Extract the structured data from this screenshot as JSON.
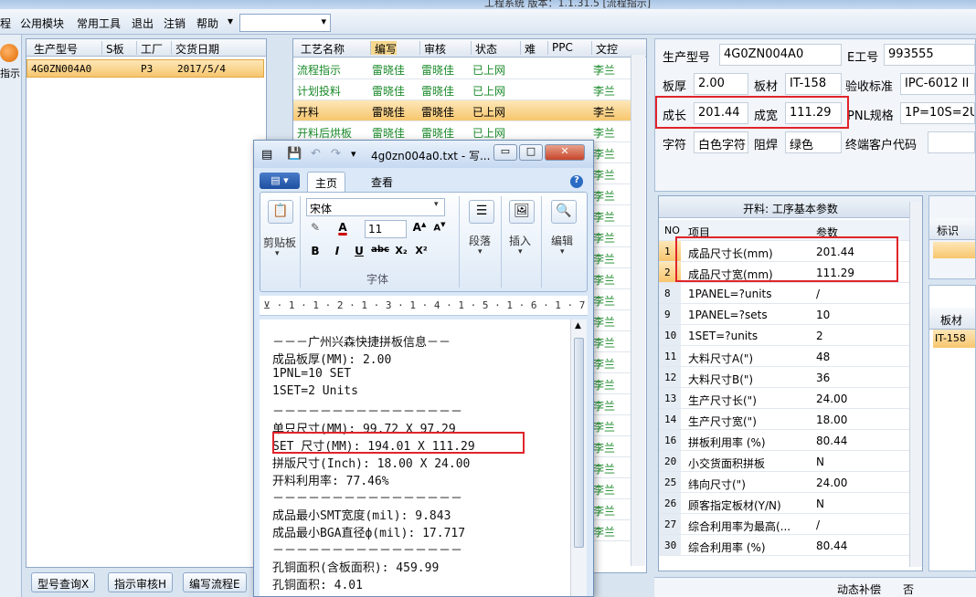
{
  "app": {
    "title": "工程系统  版本：1.1.31.5   [流程指示]"
  },
  "menu": {
    "items": [
      "程",
      "公用模块",
      "常用工具",
      "退出",
      "注销",
      "帮助"
    ],
    "combo_value": ""
  },
  "leftstrip": {
    "label": "指示"
  },
  "list": {
    "headers": [
      "生产型号",
      "S板",
      "工厂",
      "交货日期"
    ],
    "rows": [
      {
        "model": "4G0ZN004A0",
        "s": "",
        "factory": "P3",
        "date": "2017/5/4"
      }
    ]
  },
  "bottom_buttons": [
    "型号查询X",
    "指示审核H",
    "编写流程E"
  ],
  "process": {
    "headers": [
      "工艺名称",
      "编写",
      "审核",
      "状态",
      "难",
      "PPC",
      "文控"
    ],
    "rows": [
      {
        "name": "流程指示",
        "writer": "雷晓佳",
        "auditor": "雷晓佳",
        "status": "已上网",
        "ctrl": "李兰",
        "selected": false
      },
      {
        "name": "计划投料",
        "writer": "雷晓佳",
        "auditor": "雷晓佳",
        "status": "已上网",
        "ctrl": "李兰",
        "selected": false
      },
      {
        "name": "开料",
        "writer": "雷晓佳",
        "auditor": "雷晓佳",
        "status": "已上网",
        "ctrl": "李兰",
        "selected": true
      },
      {
        "name": "开料后烘板",
        "writer": "雷晓佳",
        "auditor": "雷晓佳",
        "status": "已上网",
        "ctrl": "李兰",
        "selected": false
      },
      {
        "ctrl": "李兰"
      },
      {
        "ctrl": "李兰"
      },
      {
        "ctrl": "李兰"
      },
      {
        "ctrl": "李兰"
      },
      {
        "ctrl": "李兰"
      },
      {
        "ctrl": "李兰"
      },
      {
        "ctrl": "李兰"
      },
      {
        "ctrl": "李兰"
      },
      {
        "ctrl": "李兰"
      },
      {
        "ctrl": "李兰"
      },
      {
        "ctrl": "李兰"
      },
      {
        "ctrl": "李兰"
      },
      {
        "ctrl": "李兰"
      },
      {
        "ctrl": "李兰"
      },
      {
        "ctrl": "李兰"
      },
      {
        "ctrl": "李兰"
      },
      {
        "ctrl": "李兰"
      },
      {
        "ctrl": "李兰"
      },
      {
        "ctrl": "李兰"
      }
    ]
  },
  "info": {
    "model_label": "生产型号",
    "model_value": "4G0ZN004A0",
    "eno_label": "E工号",
    "eno_value": "993555",
    "thick_label": "板厚",
    "thick_value": "2.00",
    "material_label": "板材",
    "material_value": "IT-158",
    "std_label": "验收标准",
    "std_value": "IPC-6012 II",
    "len_label": "成长",
    "len_value": "201.44",
    "wid_label": "成宽",
    "wid_value": "111.29",
    "pnl_label": "PNL规格",
    "pnl_value": "1P=10S=2U",
    "char_label": "字符",
    "char_value": "白色字符",
    "mask_label": "阻焊",
    "mask_value": "绿色",
    "cust_label": "终端客户代码",
    "cust_value": ""
  },
  "params": {
    "title": "开料: 工序基本参数",
    "headers": [
      "NO",
      "项目",
      "参数"
    ],
    "rows": [
      {
        "no": "1",
        "item": "成品尺寸长(mm)",
        "val": "201.44",
        "hl": true
      },
      {
        "no": "2",
        "item": "成品尺寸宽(mm)",
        "val": "111.29",
        "hl": true
      },
      {
        "no": "8",
        "item": "1PANEL=?units",
        "val": "/"
      },
      {
        "no": "9",
        "item": "1PANEL=?sets",
        "val": "10"
      },
      {
        "no": "10",
        "item": "1SET=?units",
        "val": "2"
      },
      {
        "no": "11",
        "item": "大料尺寸A(\")",
        "val": "48"
      },
      {
        "no": "12",
        "item": "大料尺寸B(\")",
        "val": "36"
      },
      {
        "no": "13",
        "item": "生产尺寸长(\")",
        "val": "24.00"
      },
      {
        "no": "14",
        "item": "生产尺寸宽(\")",
        "val": "18.00"
      },
      {
        "no": "16",
        "item": "拼板利用率 (%)",
        "val": "80.44"
      },
      {
        "no": "20",
        "item": "小交货面积拼板",
        "val": "N"
      },
      {
        "no": "25",
        "item": "纬向尺寸(\")",
        "val": "24.00"
      },
      {
        "no": "26",
        "item": "顾客指定板材(Y/N)",
        "val": "N"
      },
      {
        "no": "27",
        "item": "综合利用率为最高(...",
        "val": "/"
      },
      {
        "no": "30",
        "item": "综合利用率 (%)",
        "val": "80.44"
      }
    ]
  },
  "farright": {
    "tag_label": "标识",
    "mat_label": "板材",
    "mat_value": "IT-158"
  },
  "bottomright": {
    "label": "动态补偿",
    "label2": "否"
  },
  "wordpad": {
    "title": "4g0zn004a0.txt - 写...",
    "tab_home": "主页",
    "tab_view": "查看",
    "clipboard": "剪贴板",
    "font_name": "宋体",
    "font_size": "11",
    "font_group": "字体",
    "paragraph": "段落",
    "insert": "插入",
    "edit": "编辑",
    "ruler": "⊻ · 1 · 1 · 2 · 1 · 3 · 1 · 4 · 1 · 5 · 1 · 6 · 1 · 7 · 1 · 8 · 1 · 9",
    "lines": [
      "－－－广州兴森快捷拼板信息－－",
      "成品板厚(MM): 2.00",
      "1PNL=10 SET",
      "1SET=2 Units",
      "－－－－－－－－－－－－－－－－",
      "单只尺寸(MM): 99.72 X 97.29",
      "SET 尺寸(MM): 194.01 X 111.29",
      "拼版尺寸(Inch): 18.00 X 24.00",
      "开料利用率: 77.46%",
      "－－－－－－－－－－－－－－－－",
      "成品最小SMT宽度(mil): 9.843",
      "成品最小BGA直径ф(mil): 17.717",
      "－－－－－－－－－－－－－－－－",
      "孔铜面积(含板面积): 459.99",
      "孔铜面积: 4.01"
    ]
  },
  "colors": {
    "highlight_border": "#e0242a",
    "selection": "#f7c66e",
    "green_text": "#1a8a2a"
  }
}
